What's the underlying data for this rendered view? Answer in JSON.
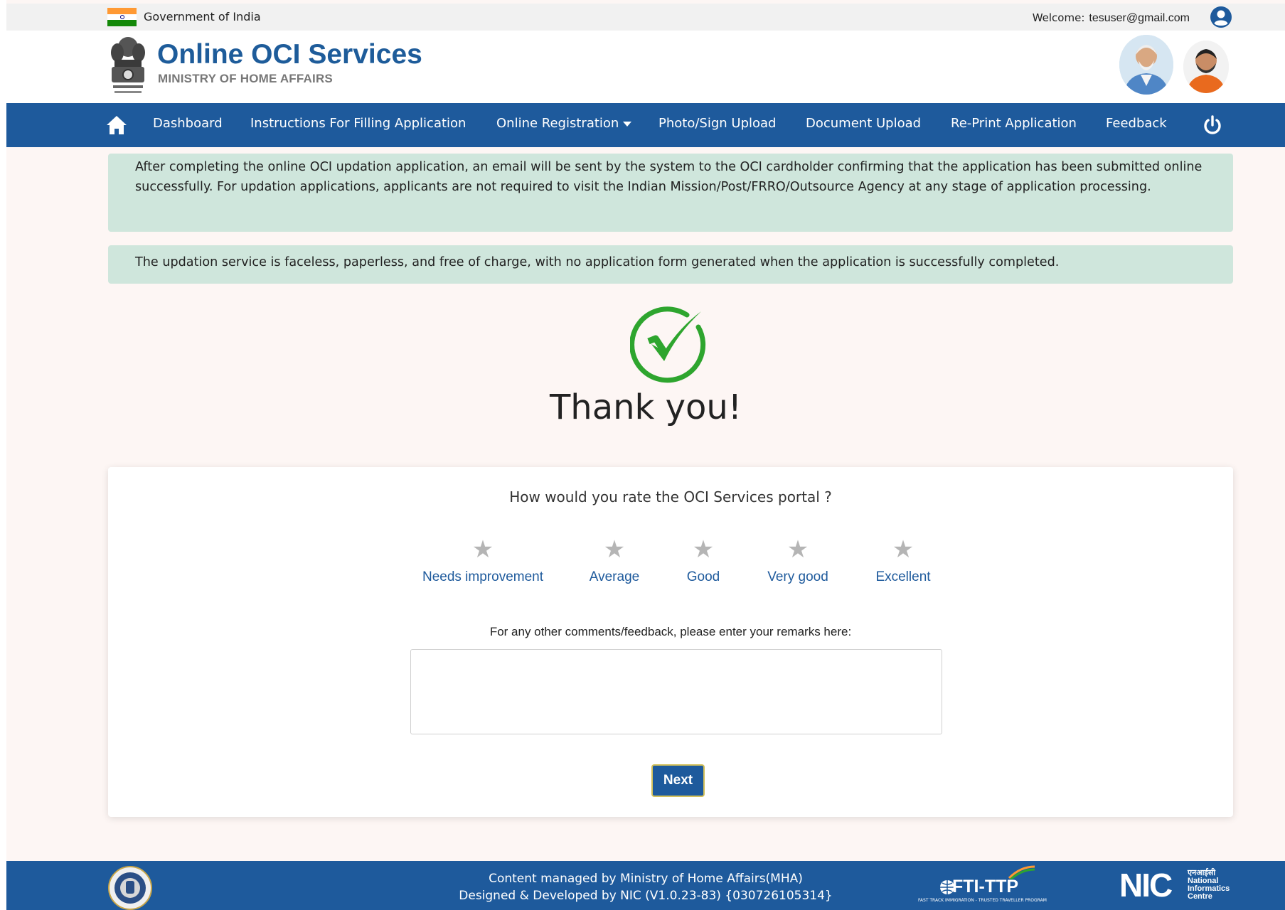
{
  "gov_bar": {
    "text": "Government of India",
    "welcome_label": "Welcome:",
    "user_email": "tesuser@gmail.com"
  },
  "header": {
    "title": "Online OCI Services",
    "subtitle": "MINISTRY OF HOME AFFAIRS"
  },
  "nav": {
    "items": [
      {
        "label": "Dashboard"
      },
      {
        "label": "Instructions For Filling Application"
      },
      {
        "label": "Online Registration"
      },
      {
        "label": "Photo/Sign Upload"
      },
      {
        "label": "Document Upload"
      },
      {
        "label": "Re-Print Application"
      },
      {
        "label": "Feedback"
      }
    ]
  },
  "notices": {
    "first": "After completing the online OCI updation application, an email will be sent by the system to the OCI cardholder confirming that the application has been submitted online successfully. For updation applications, applicants are not required to visit the Indian Mission/Post/FRRO/Outsource Agency at any stage of application processing.",
    "second": "The updation service is faceless, paperless, and free of charge, with no application form generated when the application is successfully completed."
  },
  "thank_you": "Thank you!",
  "feedback": {
    "question": "How would you rate the OCI Services portal ?",
    "ratings": [
      {
        "label": "Needs improvement"
      },
      {
        "label": "Average"
      },
      {
        "label": "Good"
      },
      {
        "label": "Very good"
      },
      {
        "label": "Excellent"
      }
    ],
    "selected_rating": 0,
    "remarks_label": "For any other comments/feedback, please enter your remarks here:",
    "remarks_value": "",
    "next_label": "Next"
  },
  "footer": {
    "line1": "Content managed by Ministry of Home Affairs(MHA)",
    "line2": "Designed & Developed by NIC (V1.0.23-83) {030726105314}",
    "fti_label": "FTI-TTP",
    "fti_sub": "FAST TRACK IMMIGRATION - TRUSTED TRAVELLER PROGRAM",
    "nic_label": "NIC",
    "nic_hindi": "एनआईसी",
    "nic_sub": [
      "National",
      "Informatics",
      "Centre"
    ]
  },
  "colors": {
    "nav_bg": "#1e5a9c",
    "title_blue": "#1e5c9a",
    "notice_bg": "#cfe6dc",
    "success_green": "#2ea52e",
    "star_grey": "#b5b5b5"
  },
  "icons": [
    "indian-flag-icon",
    "user-avatar-icon",
    "national-emblem-icon",
    "home-icon",
    "caret-down-icon",
    "power-icon",
    "success-check-icon",
    "star-icon",
    "mha-seal-icon",
    "fti-ttp-logo",
    "nic-logo"
  ]
}
